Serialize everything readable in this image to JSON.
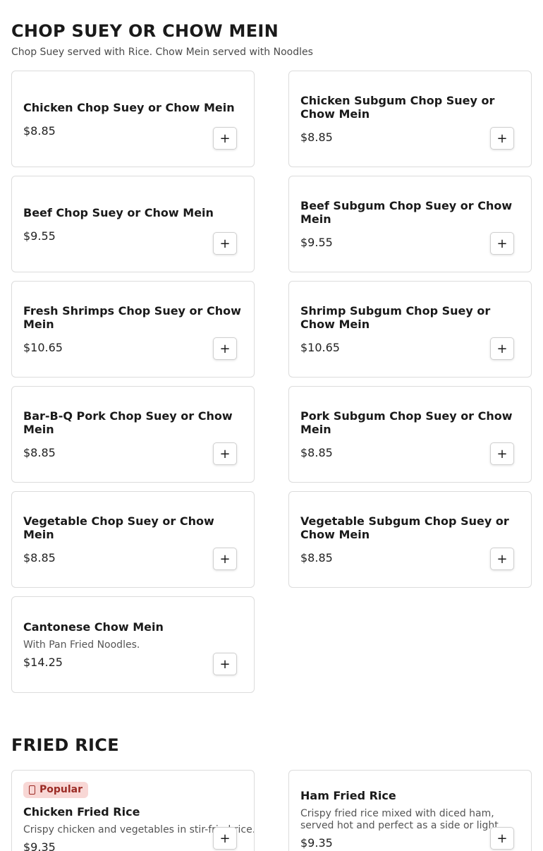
{
  "sections": [
    {
      "title": "CHOP SUEY OR CHOW MEIN",
      "subtitle": "Chop Suey served with Rice. Chow Mein served with Noodles",
      "items": [
        {
          "name": "Chicken Chop Suey or Chow Mein",
          "price": "$8.85"
        },
        {
          "name": "Chicken Subgum Chop Suey or Chow Mein",
          "price": "$8.85"
        },
        {
          "name": "Beef Chop Suey or Chow Mein",
          "price": "$9.55"
        },
        {
          "name": "Beef Subgum Chop Suey or Chow Mein",
          "price": "$9.55"
        },
        {
          "name": "Fresh Shrimps Chop Suey or Chow Mein",
          "price": "$10.65"
        },
        {
          "name": "Shrimp Subgum Chop Suey or Chow Mein",
          "price": "$10.65"
        },
        {
          "name": "Bar-B-Q Pork Chop Suey or Chow Mein",
          "price": "$8.85"
        },
        {
          "name": "Pork Subgum Chop Suey or Chow Mein",
          "price": "$8.85"
        },
        {
          "name": "Vegetable Chop Suey or Chow Mein",
          "price": "$8.85"
        },
        {
          "name": "Vegetable Subgum Chop Suey or Chow Mein",
          "price": "$8.85"
        },
        {
          "name": "Cantonese Chow Mein",
          "description": "With Pan Fried Noodles.",
          "price": "$14.25"
        }
      ]
    },
    {
      "title": "FRIED RICE",
      "items": [
        {
          "badge": "Popular",
          "badge_icon": "popular-icon",
          "name": "Chicken Fried Rice",
          "description": "Crispy chicken and vegetables in stir-fried rice.",
          "price": "$9.35"
        },
        {
          "name": "Ham Fried Rice",
          "description": "Crispy fried rice mixed with diced ham, served hot and perfect as a side or light meal.",
          "price": "$9.35"
        }
      ]
    }
  ],
  "add_button_label": "+",
  "colors": {
    "badge_bg": "#f8d7d5",
    "badge_text": "#9b2b25",
    "card_border": "#dcdcdc"
  }
}
